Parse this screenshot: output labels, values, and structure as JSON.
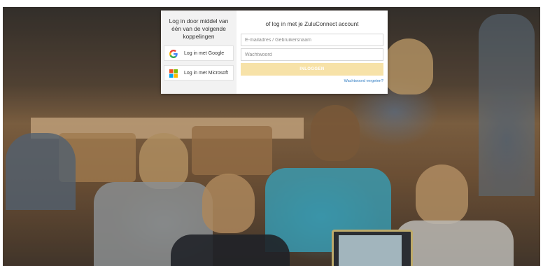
{
  "login": {
    "left_intro": "Log in door middel van één van de volgende koppelingen",
    "google_label": "Log in met Google",
    "microsoft_label": "Log in met Microsoft",
    "right_title": "of log in met je ZuluConnect account",
    "email_placeholder": "E-mailadres / Gebruikersnaam",
    "password_placeholder": "Wachtwoord",
    "submit_label": "INLOGGEN",
    "forgot_label": "Wachtwoord vergeten?"
  },
  "icons": {
    "google": "google-icon",
    "microsoft": "microsoft-icon"
  },
  "colors": {
    "submit_bg": "#f7e2a8",
    "forgot_link": "#2f7cc3",
    "google_blue": "#4285f4",
    "google_red": "#ea4335",
    "google_yellow": "#fbbc05",
    "google_green": "#34a853",
    "ms_red": "#f25022",
    "ms_green": "#7fba00",
    "ms_blue": "#00a4ef",
    "ms_yellow": "#ffb900"
  }
}
